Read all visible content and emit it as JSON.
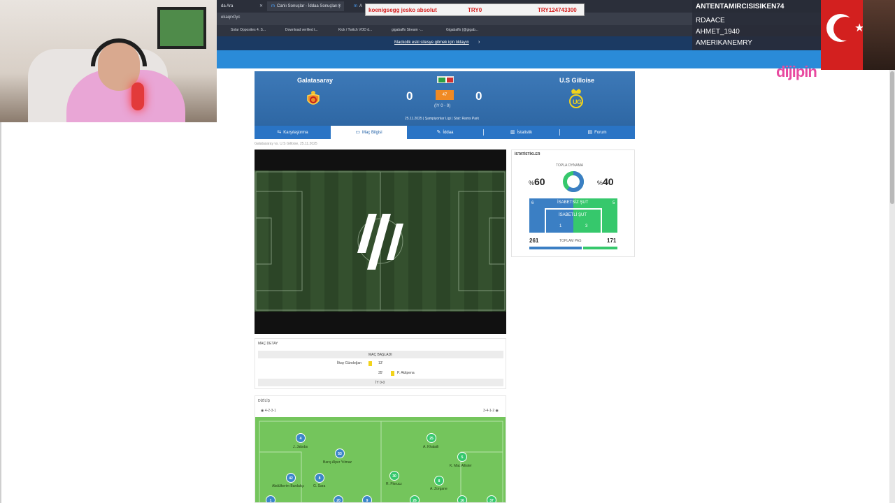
{
  "browser": {
    "tabs": [
      {
        "label": "da Ara"
      },
      {
        "label": "Canlı Sonuçlar - İddaa Sonuçları |"
      },
      {
        "label": "A"
      }
    ],
    "address": "ekaqrx0yc",
    "bookmarks": [
      "Solar Opposites 4. S...",
      "Download verified t...",
      "Kick / Twitch VOD d...",
      "gigabaffx Stream -...",
      "Gigabaffx (@gigab..."
    ],
    "banner_link": "Mackolik eski sitesye gitmek için tıklayın"
  },
  "stream": {
    "alert_item": "koenigsegg jesko absolut",
    "alert_price1": "TRY0",
    "alert_price2": "TRY124743300",
    "names": [
      "ANTENTAMIRCISISIKEN74",
      "RDAACE",
      "AHMET_1940",
      "AMERIKANEMRY"
    ],
    "logo": "dijipin"
  },
  "match": {
    "home": "Galatasaray",
    "away": "U.S Gilloise",
    "home_score": "0",
    "away_score": "0",
    "minute": "47",
    "halftime": "(İY 0 - 0)",
    "info": "25.11.2025 | Şampiyonlar Ligi | Stat: Rams Park",
    "breadcrumb": "Galatasaray vs. U.S Gilloise, 25.11.2025"
  },
  "tabs": {
    "karsilastirma": "Karşılaştırma",
    "mac_bilgisi": "Maç Bilgisi",
    "iddaa": "İddaa",
    "istatistik": "İstatistik",
    "forum": "Forum"
  },
  "stats": {
    "title": "İSTATİSTİKLER",
    "possession_label": "TOPLA OYNAMA",
    "possession_home": "60",
    "possession_away": "40",
    "pct": "%",
    "off_target_label": "İSABETSİZ ŞUT",
    "off_target_home": "6",
    "off_target_away": "5",
    "on_target_label": "İSABETLİ ŞUT",
    "on_target_home": "1",
    "on_target_away": "3",
    "passes_label": "TOPLAM PAS",
    "passes_home": "261",
    "passes_away": "171",
    "colors": {
      "home": "#3b7fc4",
      "away": "#36c86c"
    }
  },
  "detail": {
    "title": "MAÇ DETAY",
    "header": "MAÇ BAŞLADI",
    "event1_player": "İlkay Gündoğan",
    "event1_min": "13'",
    "event2_min": "35'",
    "event2_player": "P. Akitpena",
    "halftime_row": "İY 0-0"
  },
  "lineup": {
    "title": "DİZİLİŞ",
    "home_form": "4-2-3-1",
    "away_form": "3-4-1-2",
    "home_players": [
      {
        "no": "4",
        "name": "J. Jakobs"
      },
      {
        "no": "53",
        "name": "Barış Alper Yılmaz"
      },
      {
        "no": "42",
        "name": "Abdülkerim Bardakçı"
      },
      {
        "no": "8",
        "name": "G. Sara"
      },
      {
        "no": "1",
        "name": ""
      },
      {
        "no": "20",
        "name": ""
      },
      {
        "no": "9",
        "name": ""
      }
    ],
    "away_players": [
      {
        "no": "25",
        "name": "A. Khalaili"
      },
      {
        "no": "5",
        "name": "K. Mac Allister"
      },
      {
        "no": "30",
        "name": "R. Florucz"
      },
      {
        "no": "8",
        "name": "A. Zorgane"
      },
      {
        "no": "26",
        "name": ""
      },
      {
        "no": "16",
        "name": ""
      },
      {
        "no": "37",
        "name": ""
      }
    ]
  }
}
